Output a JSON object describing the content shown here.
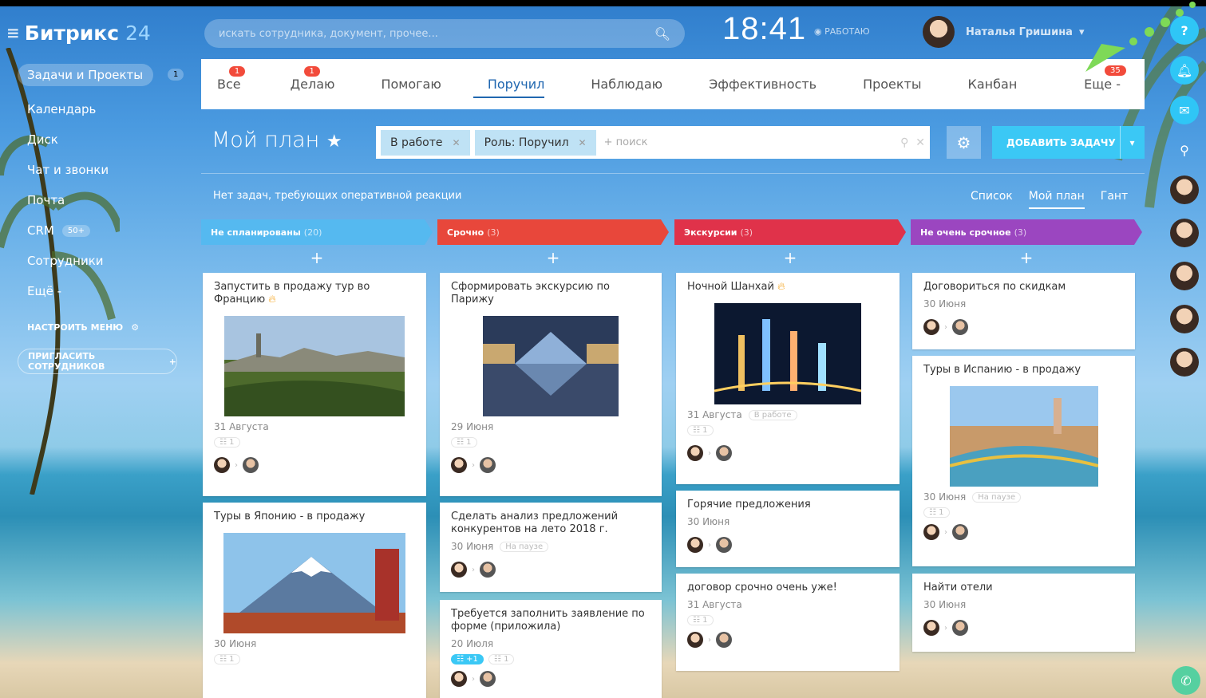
{
  "app": {
    "name": "Битрикс",
    "suffix": "24"
  },
  "search": {
    "placeholder": "искать сотрудника, документ, прочее..."
  },
  "clock": "18:41",
  "status": "РАБОТАЮ",
  "user": {
    "name": "Наталья Гришина"
  },
  "sidebar": {
    "items": [
      {
        "label": "Задачи и Проекты",
        "badge": "1"
      },
      {
        "label": "Календарь"
      },
      {
        "label": "Диск"
      },
      {
        "label": "Чат и звонки"
      },
      {
        "label": "Почта"
      },
      {
        "label": "CRM",
        "badge": "50+"
      },
      {
        "label": "Сотрудники"
      },
      {
        "label": "Ещё -"
      }
    ],
    "configure": "НАСТРОИТЬ МЕНЮ",
    "invite": "ПРИГЛАСИТЬ СОТРУДНИКОВ"
  },
  "tabs": [
    {
      "label": "Все",
      "count": "1"
    },
    {
      "label": "Делаю",
      "count": "1"
    },
    {
      "label": "Помогаю"
    },
    {
      "label": "Поручил"
    },
    {
      "label": "Наблюдаю"
    },
    {
      "label": "Эффективность"
    },
    {
      "label": "Проекты"
    },
    {
      "label": "Канбан"
    },
    {
      "label": "Еще -",
      "count": "35"
    }
  ],
  "page": {
    "title": "Мой план"
  },
  "filter": {
    "chips": [
      "В работе",
      "Роль: Поручил"
    ],
    "placeholder": "+ поиск"
  },
  "add_task": "ДОБАВИТЬ ЗАДАЧУ",
  "notice": "Нет задач, требующих оперативной реакции",
  "views": [
    "Список",
    "Мой план",
    "Гант"
  ],
  "columns": [
    {
      "title": "Не спланированы",
      "count": "(20)",
      "color": "#55b9f0"
    },
    {
      "title": "Срочно",
      "count": "(3)",
      "color": "#e8473b"
    },
    {
      "title": "Экскурсии",
      "count": "(3)",
      "color": "#e0324a"
    },
    {
      "title": "Не очень срочное",
      "count": "(3)",
      "color": "#9b46c0"
    }
  ],
  "cards": {
    "c1": {
      "title": "Запустить в продажу тур во Францию",
      "date": "31 Августа",
      "checklist": "1"
    },
    "c2": {
      "title": "Туры в Японию - в продажу",
      "date": "30 Июня",
      "checklist": "1"
    },
    "c3": {
      "title": "Сформировать экскурсию по Парижу",
      "date": "29 Июня",
      "checklist": "1"
    },
    "c4": {
      "title": "Сделать анализ предложений конкурентов на лето 2018 г.",
      "date": "30 Июня",
      "status": "На паузе"
    },
    "c5": {
      "title": "Требуется заполнить заявление по форме (приложила)",
      "date": "20 Июля",
      "checklist_blue": "+1",
      "checklist": "1"
    },
    "c6": {
      "title": "Ночной Шанхай",
      "date": "31 Августа",
      "status": "В работе",
      "checklist": "1"
    },
    "c7": {
      "title": "Горячие предложения",
      "date": "30 Июня"
    },
    "c8": {
      "title": "договор срочно очень уже!",
      "date": "31 Августа",
      "checklist": "1"
    },
    "c9": {
      "title": "Договориться по скидкам",
      "date": "30 Июня"
    },
    "c10": {
      "title": "Туры в Испанию - в продажу",
      "date": "30 Июня",
      "status": "На паузе",
      "checklist": "1"
    },
    "c11": {
      "title": "Найти отели",
      "date": "30 Июня"
    }
  }
}
